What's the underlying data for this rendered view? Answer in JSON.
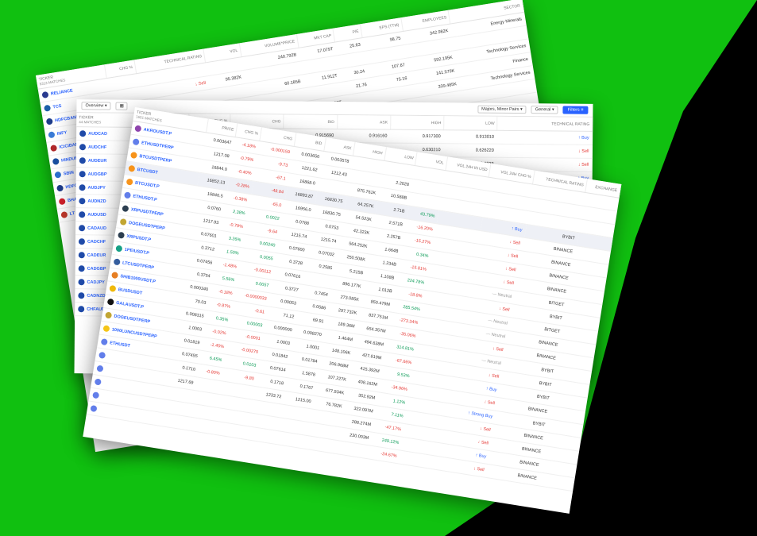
{
  "back": {
    "ticker_header": "TICKER",
    "matches": "5313 MATCHES",
    "columns": [
      "CHG %",
      "TECHNICAL RATING",
      "VOL",
      "VOLUME*PRICE",
      "MKT CAP",
      "P/E",
      "EPS (TTM)",
      "EMPLOYEES",
      "SECTOR"
    ],
    "rows": [
      {
        "ticker": "RELIANCE",
        "chg": "",
        "rating": "",
        "vol": "",
        "vp": "240.792B",
        "mcap": "17.079T",
        "pe": "25.63",
        "eps": "98.75",
        "emp": "342.982K",
        "sector": "Energy Minerals",
        "color": "#2a3a8f"
      },
      {
        "ticker": "TCS",
        "chg": "",
        "rating": "↓ Sell",
        "vol": "95.382K",
        "vp": "",
        "mcap": "",
        "pe": "",
        "eps": "",
        "emp": "",
        "sector": "",
        "color": "#1c5fa8"
      },
      {
        "ticker": "HDFCBANK",
        "chg": "",
        "rating": "",
        "vol": "",
        "vp": "60.185B",
        "mcap": "11.912T",
        "pe": "30.24",
        "eps": "107.67",
        "emp": "592.195K",
        "sector": "Technology Services",
        "color": "#1e3c8a"
      },
      {
        "ticker": "INFY",
        "chg": "",
        "rating": "↓ Sell",
        "vol": "48.464K",
        "vp": "",
        "mcap": "",
        "pe": "21.76",
        "eps": "75.16",
        "emp": "141.579K",
        "sector": "Finance",
        "color": "#3a7bd5"
      },
      {
        "ticker": "ICICIBANK",
        "chg": "",
        "rating": "",
        "vol": "",
        "vp": "",
        "mcap": "9.087T",
        "pe": "",
        "eps": "",
        "emp": "339.485K",
        "sector": "Technology Services",
        "color": "#b0282a"
      },
      {
        "ticker": "HINDUNILVR",
        "chg": "",
        "rating": "",
        "vol": "",
        "vp": "",
        "mcap": "",
        "pe": "",
        "eps": "",
        "emp": "",
        "sector": "",
        "color": "#1a4fa0"
      },
      {
        "ticker": "SBIN",
        "chg": "",
        "rating": "",
        "vol": "",
        "vp": "",
        "mcap": "",
        "pe": "",
        "eps": "",
        "emp": "",
        "sector": "",
        "color": "#2c6fd0"
      },
      {
        "ticker": "HDFC",
        "chg": "",
        "rating": "",
        "vol": "",
        "vp": "",
        "mcap": "",
        "pe": "",
        "eps": "",
        "emp": "",
        "sector": "",
        "color": "#1e3c8a"
      },
      {
        "ticker": "BHARTIARTL",
        "chg": "",
        "rating": "",
        "vol": "",
        "vp": "",
        "mcap": "",
        "pe": "",
        "eps": "",
        "emp": "",
        "sector": "",
        "color": "#d0202a"
      },
      {
        "ticker": "LT",
        "chg": "",
        "rating": "",
        "vol": "",
        "vp": "",
        "mcap": "",
        "pe": "",
        "eps": "",
        "emp": "",
        "sector": "",
        "color": "#c0392b"
      }
    ]
  },
  "mid": {
    "view_label": "Overview",
    "filter_majors": "Majors, Minor Pairs",
    "filter_general": "General",
    "filters_btn": "Filters",
    "ticker_header": "TICKER",
    "matches": "44 MATCHES",
    "columns": [
      "PRICE",
      "CHG %",
      "CHG",
      "BID",
      "ASK",
      "HIGH",
      "LOW",
      "TECHNICAL RATING"
    ],
    "rows": [
      {
        "ticker": "AUDCAD",
        "price": "",
        "chgp": "",
        "chg": "0.002850",
        "bid": "0.915690",
        "ask": "0.916160",
        "high": "0.917300",
        "low": "0.913010",
        "rating": "↑ Buy",
        "rc": "buy",
        "cc": "pos"
      },
      {
        "ticker": "AUDCHF",
        "price": "",
        "chgp": "",
        "chg": "-0.00170",
        "bid": "0.628680",
        "ask": "0.630000",
        "high": "0.630210",
        "low": "0.626220",
        "rating": "↓ Sell",
        "rc": "sell",
        "cc": "neg"
      },
      {
        "ticker": "AUDEUR",
        "price": "",
        "chgp": "",
        "chg": "",
        "bid": "0.6250",
        "ask": "0.6252",
        "high": "0.6253",
        "low": "0.6222",
        "rating": "↓ Sell",
        "rc": "sell",
        "cc": "neg"
      },
      {
        "ticker": "AUDGBP",
        "price": "",
        "chgp": "",
        "chg": "",
        "bid": "0.5611",
        "ask": "",
        "high": "0.5603",
        "low": "0.5572",
        "rating": "↑ Buy",
        "rc": "buy",
        "cc": "pos"
      },
      {
        "ticker": "AUDJPY",
        "price": "",
        "chgp": "",
        "chg": "",
        "bid": "",
        "ask": "",
        "high": "90.134",
        "low": "89.345",
        "rating": "↓ Sell",
        "rc": "sell",
        "cc": "neg"
      },
      {
        "ticker": "AUDNZD",
        "price": "",
        "chgp": "",
        "chg": "",
        "bid": "",
        "ask": "",
        "high": "",
        "low": "1.067980",
        "rating": "— Neutral",
        "rc": "neu",
        "cc": "pos"
      },
      {
        "ticker": "AUDUSD",
        "price": "",
        "chgp": "",
        "chg": "",
        "bid": "",
        "ask": "",
        "high": "",
        "low": "",
        "rating": "",
        "rc": "neu",
        "cc": "pos"
      },
      {
        "ticker": "CADAUD",
        "price": "",
        "chgp": "",
        "chg": "",
        "bid": "",
        "ask": "",
        "high": "",
        "low": "",
        "rating": "",
        "rc": "neu",
        "cc": "pos"
      },
      {
        "ticker": "CADCHF",
        "price": "",
        "chgp": "",
        "chg": "",
        "bid": "",
        "ask": "",
        "high": "",
        "low": "",
        "rating": "",
        "rc": "neu",
        "cc": "pos"
      },
      {
        "ticker": "CADEUR",
        "price": "",
        "chgp": "",
        "chg": "",
        "bid": "",
        "ask": "",
        "high": "",
        "low": "",
        "rating": "",
        "rc": "neu",
        "cc": "pos"
      },
      {
        "ticker": "CADGBP",
        "price": "",
        "chgp": "",
        "chg": "",
        "bid": "",
        "ask": "",
        "high": "",
        "low": "",
        "rating": "",
        "rc": "neu",
        "cc": "pos"
      },
      {
        "ticker": "CADJPY",
        "price": "",
        "chgp": "",
        "chg": "",
        "bid": "",
        "ask": "",
        "high": "",
        "low": "",
        "rating": "",
        "rc": "neu",
        "cc": "pos"
      },
      {
        "ticker": "CADNZD",
        "price": "",
        "chgp": "",
        "chg": "",
        "bid": "",
        "ask": "",
        "high": "",
        "low": "",
        "rating": "",
        "rc": "neu",
        "cc": "pos"
      },
      {
        "ticker": "CHFAUD",
        "price": "",
        "chgp": "",
        "chg": "",
        "bid": "",
        "ask": "",
        "high": "",
        "low": "",
        "rating": "",
        "rc": "neu",
        "cc": "pos"
      }
    ]
  },
  "front": {
    "ticker_header": "TICKER",
    "matches": "1651 MATCHES",
    "columns": [
      "PRICE",
      "CHG %",
      "CHG",
      "BID",
      "ASK",
      "HIGH",
      "LOW",
      "VOL",
      "VOL 24H IN USD",
      "VOL 24H CHG %",
      "TECHNICAL RATING",
      "EXCHANGE"
    ],
    "rows": [
      {
        "ticker": "AKROUSDT.P",
        "price": "0.003647",
        "chgp": "-4.18%",
        "chg": "-0.000159",
        "bid": "0.003650",
        "ask": "0.003578",
        "high": "",
        "low": "",
        "vol": "",
        "v24": "",
        "v24c": "",
        "rating": "",
        "exch": "",
        "color": "#8e44ad"
      },
      {
        "ticker": "ETHUSDTPERP",
        "price": "1217.08",
        "chgp": "-0.79%",
        "chg": "-9.73",
        "bid": "1221.62",
        "ask": "1212.43",
        "high": "",
        "low": "2.2028",
        "vol": "",
        "v24": "",
        "v24c": "",
        "rating": "",
        "exch": "",
        "color": "#627eea"
      },
      {
        "ticker": "BTCUSDTPERP",
        "price": "16844.0",
        "chgp": "-0.40%",
        "chg": "-67.1",
        "bid": "16868.0",
        "ask": "",
        "high": "875.761K",
        "low": "10.588B",
        "vol": "",
        "v24": "",
        "v24c": "",
        "rating": "",
        "exch": "",
        "color": "#f7931a"
      },
      {
        "ticker": "BTCUSDT",
        "price": "16852.13",
        "chgp": "-0.28%",
        "chg": "-48.84",
        "bid": "16893.87",
        "ask": "16830.75",
        "high": "64.257K",
        "low": "2.71B",
        "vol": "43.79%",
        "v24": "",
        "v24c": "↑ Buy",
        "rating": "BYBIT",
        "exch": "",
        "color": "#f7931a"
      },
      {
        "ticker": "BTCUSDT.P",
        "price": "16840.5",
        "chgp": "-0.38%",
        "chg": "-65.0",
        "bid": "16956.0",
        "ask": "16830.75",
        "high": "54.523K",
        "low": "2.571B",
        "vol": "-16.20%",
        "v24": "",
        "v24c": "↓ Sell",
        "rating": "BINANCE",
        "exch": "",
        "color": "#f7931a"
      },
      {
        "ticker": "ETHUSDT.P",
        "price": "0.0760",
        "chgp": "2.38%",
        "chg": "0.0022",
        "bid": "0.0788",
        "ask": "0.0753",
        "high": "42.323K",
        "low": "2.257B",
        "vol": "-15.27%",
        "v24": "",
        "v24c": "↓ Sell",
        "rating": "BINANCE",
        "exch": "",
        "color": "#627eea"
      },
      {
        "ticker": "XRPUSDTPERP",
        "price": "1217.93",
        "chgp": "-0.79%",
        "chg": "-9.64",
        "bid": "1215.74",
        "ask": "1215.74",
        "high": "564.252K",
        "low": "1.664B",
        "vol": "0.34%",
        "v24": "",
        "v24c": "↓ Sell",
        "rating": "BINANCE",
        "exch": "",
        "color": "#2c3e50"
      },
      {
        "ticker": "DOGEUSDTPERP",
        "price": "0.07601",
        "chgp": "3.26%",
        "chg": "0.00240",
        "bid": "0.07600",
        "ask": "0.07032",
        "high": "250.508K",
        "low": "1.234B",
        "vol": "-15.81%",
        "v24": "",
        "v24c": "↓ Sell",
        "rating": "BINANCE",
        "exch": "",
        "color": "#c2a633"
      },
      {
        "ticker": "XRPUSDT.P",
        "price": "0.3712",
        "chgp": "1.50%",
        "chg": "0.0055",
        "bid": "0.3728",
        "ask": "0.2585",
        "high": "5.215B",
        "low": "1.108B",
        "vol": "224.78%",
        "v24": "",
        "v24c": "— Neutral",
        "rating": "BITGET",
        "exch": "",
        "color": "#2c3e50"
      },
      {
        "ticker": "1PEIUSDT.P",
        "price": "0.07456",
        "chgp": "-1.48%",
        "chg": "-0.00112",
        "bid": "0.07616",
        "ask": "",
        "high": "896.177K",
        "low": "1.012B",
        "vol": "-18.8%",
        "v24": "",
        "v24c": "↓ Sell",
        "rating": "BYBIT",
        "exch": "",
        "color": "#16a085"
      },
      {
        "ticker": "LTCUSDTPERP",
        "price": "0.3754",
        "chgp": "5.56%",
        "chg": "0.0057",
        "bid": "0.3727",
        "ask": "0.7454",
        "high": "273.085K",
        "low": "850.479M",
        "vol": "285.54%",
        "v24": "",
        "v24c": "— Neutral",
        "rating": "BITGET",
        "exch": "",
        "color": "#345d9d"
      },
      {
        "ticker": "SHIB1000USDT.P",
        "price": "0.000340",
        "chgp": "-0.18%",
        "chg": "-0.0000033",
        "bid": "0.00053",
        "ask": "0.0586",
        "high": "297.732K",
        "low": "837.751M",
        "vol": "-273.34%",
        "v24": "",
        "v24c": "— Neutral",
        "rating": "BINANCE",
        "exch": "",
        "color": "#e67e22"
      },
      {
        "ticker": "BUSDUSDT",
        "price": "70.03",
        "chgp": "-0.87%",
        "chg": "-0.61",
        "bid": "71.12",
        "ask": "69.91",
        "high": "189.36M",
        "low": "654.357M",
        "vol": "-35.06%",
        "v24": "",
        "v24c": "↓ Sell",
        "rating": "BINANCE",
        "exch": "",
        "color": "#f0b90b"
      },
      {
        "ticker": "GALAUSDT.P",
        "price": "0.008315",
        "chgp": "0.35%",
        "chg": "0.00003",
        "bid": "0.000000",
        "ask": "0.008270",
        "high": "1.464M",
        "low": "494.638M",
        "vol": "314.81%",
        "v24": "",
        "v24c": "— Neutral",
        "rating": "BYBIT",
        "exch": "",
        "color": "#111111"
      },
      {
        "ticker": "DOGEUSDTPERP",
        "price": "1.0003",
        "chgp": "-0.02%",
        "chg": "-0.0001",
        "bid": "1.0003",
        "ask": "1.0001",
        "high": "148.106K",
        "low": "427.819M",
        "vol": "-67.66%",
        "v24": "",
        "v24c": "↓ Sell",
        "rating": "BYBIT",
        "exch": "",
        "color": "#c2a633"
      },
      {
        "ticker": "1000LUNCUSDTPERP",
        "price": "0.01819",
        "chgp": "-1.45%",
        "chg": "-0.00270",
        "bid": "0.01842",
        "ask": "0.01784",
        "high": "206.968M",
        "low": "415.392M",
        "vol": "9.53%",
        "v24": "",
        "v24c": "↑ Buy",
        "rating": "BYBIT",
        "exch": "",
        "color": "#f5c518"
      },
      {
        "ticker": "ETHUSDT",
        "price": "0.07455",
        "chgp": "6.45%",
        "chg": "0.0103",
        "bid": "0.07614",
        "ask": "1.5878",
        "high": "107.227K",
        "low": "408.162M",
        "vol": "-34.96%",
        "v24": "",
        "v24c": "↓ Sell",
        "rating": "BINANCE",
        "exch": "",
        "color": "#627eea"
      },
      {
        "ticker": "",
        "price": "0.1710",
        "chgp": "-0.80%",
        "chg": "-9.80",
        "bid": "0.1718",
        "ask": "0.1767",
        "high": "677.934K",
        "low": "352.92M",
        "vol": "1.12%",
        "v24": "",
        "v24c": "↑ Strong Buy",
        "rating": "BYBIT",
        "exch": "",
        "color": "#627eea"
      },
      {
        "ticker": "",
        "price": "1217.69",
        "chgp": "",
        "chg": "",
        "bid": "1233.72",
        "ask": "1215.00",
        "high": "76.782K",
        "low": "322.097M",
        "vol": "7.11%",
        "v24": "",
        "v24c": "↓ Sell",
        "rating": "BINANCE",
        "exch": "",
        "color": "#627eea"
      },
      {
        "ticker": "",
        "price": "",
        "chgp": "",
        "chg": "",
        "bid": "",
        "ask": "",
        "high": "",
        "low": "288.274M",
        "vol": "-47.17%",
        "v24": "",
        "v24c": "↓ Sell",
        "rating": "BINANCE",
        "exch": "",
        "color": "#627eea"
      },
      {
        "ticker": "",
        "price": "",
        "chgp": "",
        "chg": "",
        "bid": "",
        "ask": "",
        "high": "",
        "low": "230.003M",
        "vol": "249.12%",
        "v24": "",
        "v24c": "↑ Buy",
        "rating": "BINANCE",
        "exch": "",
        "color": "#627eea"
      },
      {
        "ticker": "",
        "price": "",
        "chgp": "",
        "chg": "",
        "bid": "",
        "ask": "",
        "high": "",
        "low": "",
        "vol": "-24.67%",
        "v24": "",
        "v24c": "↓ Sell",
        "rating": "BINANCE",
        "exch": "",
        "color": "#627eea"
      }
    ]
  }
}
